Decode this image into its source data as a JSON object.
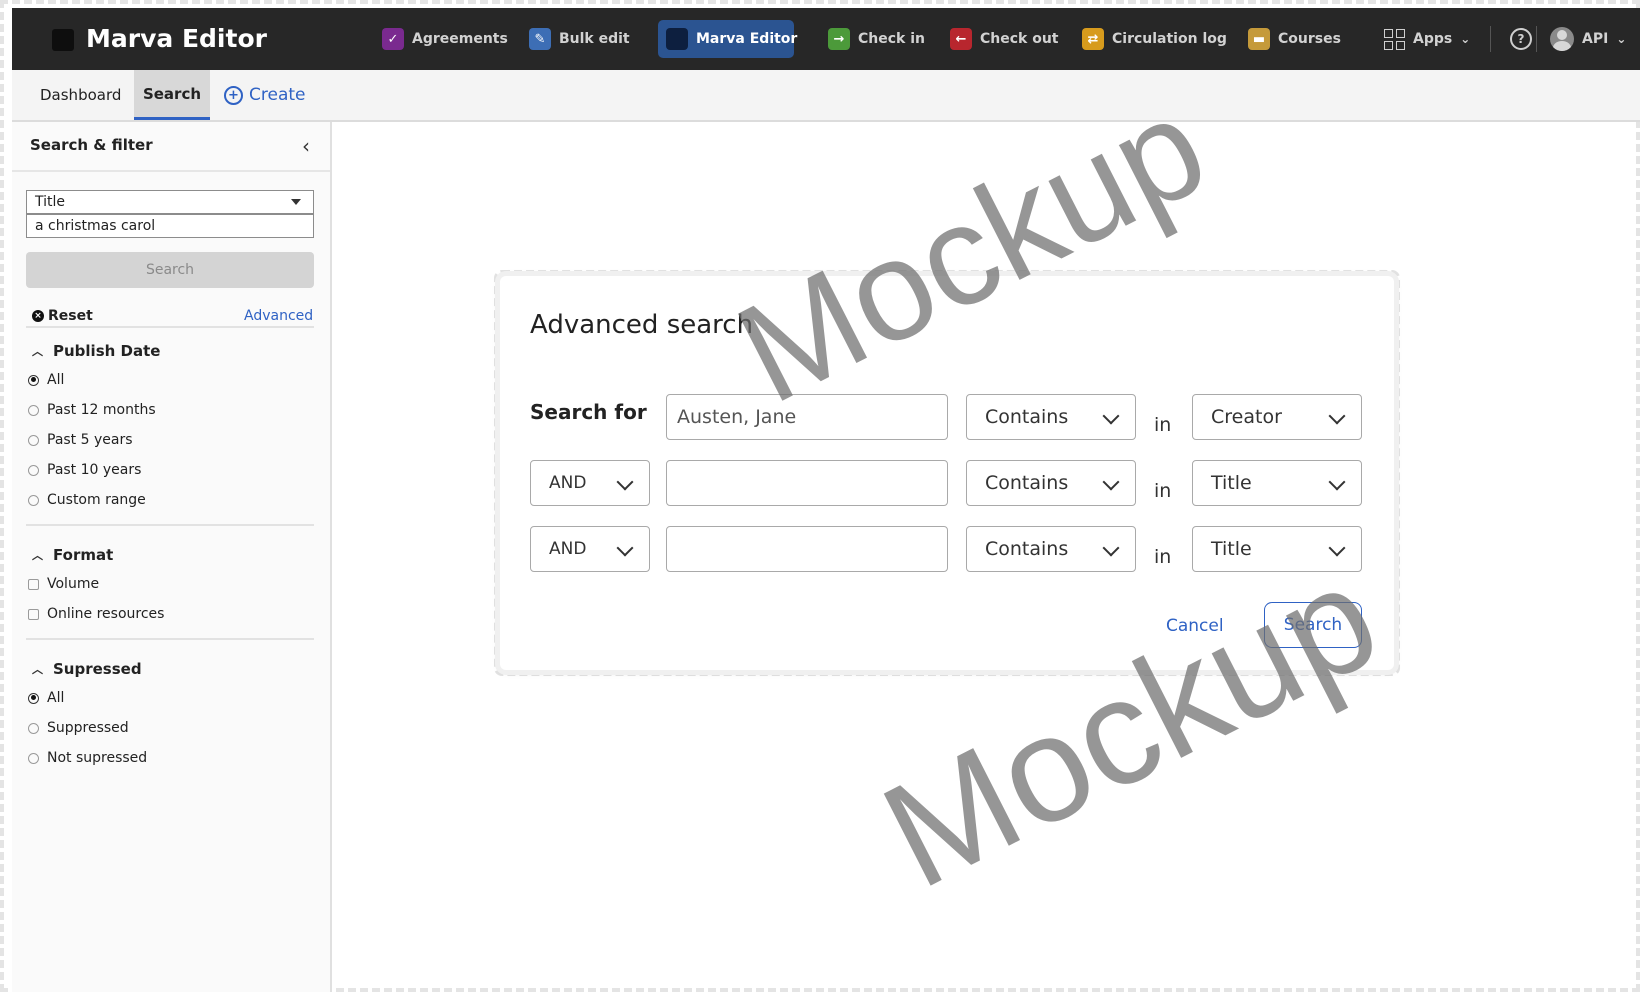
{
  "app": {
    "name": "Marva Editor"
  },
  "topnav": {
    "items": [
      {
        "label": "Agreements",
        "icon": "agreements-icon",
        "color": "#7a2a8f"
      },
      {
        "label": "Bulk edit",
        "icon": "bulk-edit-icon",
        "color": "#3d6eb5"
      },
      {
        "label": "Marva Editor",
        "icon": "marva-editor-icon",
        "color": "#0d1f3f",
        "active": true
      },
      {
        "label": "Check in",
        "icon": "check-in-icon",
        "color": "#4c9a3a"
      },
      {
        "label": "Check out",
        "icon": "check-out-icon",
        "color": "#b8262e"
      },
      {
        "label": "Circulation log",
        "icon": "circulation-log-icon",
        "color": "#d79b1d"
      },
      {
        "label": "Courses",
        "icon": "courses-icon",
        "color": "#c59a3a"
      }
    ],
    "apps_label": "Apps",
    "user_label": "API"
  },
  "subnav": {
    "dashboard": "Dashboard",
    "search": "Search",
    "create": "Create"
  },
  "sidebar": {
    "title": "Search & filter",
    "field_select": "Title",
    "query": "a christmas carol",
    "search_button": "Search",
    "reset": "Reset",
    "advanced": "Advanced",
    "publish_date": {
      "title": "Publish Date",
      "options": [
        "All",
        "Past 12 months",
        "Past 5 years",
        "Past 10 years",
        "Custom range"
      ],
      "selected": "All"
    },
    "format": {
      "title": "Format",
      "options": [
        "Volume",
        "Online resources"
      ]
    },
    "suppressed": {
      "title": "Supressed",
      "options": [
        "All",
        "Suppressed",
        "Not supressed"
      ],
      "selected": "All"
    }
  },
  "modal": {
    "title": "Advanced search",
    "search_for": "Search for",
    "in_label": "in",
    "rows": [
      {
        "operator": null,
        "value": "Austen, Jane",
        "match": "Contains",
        "field": "Creator"
      },
      {
        "operator": "AND",
        "value": "",
        "match": "Contains",
        "field": "Title"
      },
      {
        "operator": "AND",
        "value": "",
        "match": "Contains",
        "field": "Title"
      }
    ],
    "cancel": "Cancel",
    "search": "Search"
  },
  "watermark": "Mockup",
  "colors": {
    "topbar": "#272727",
    "accent": "#2f62c4",
    "active_nav": "#2b5491"
  }
}
